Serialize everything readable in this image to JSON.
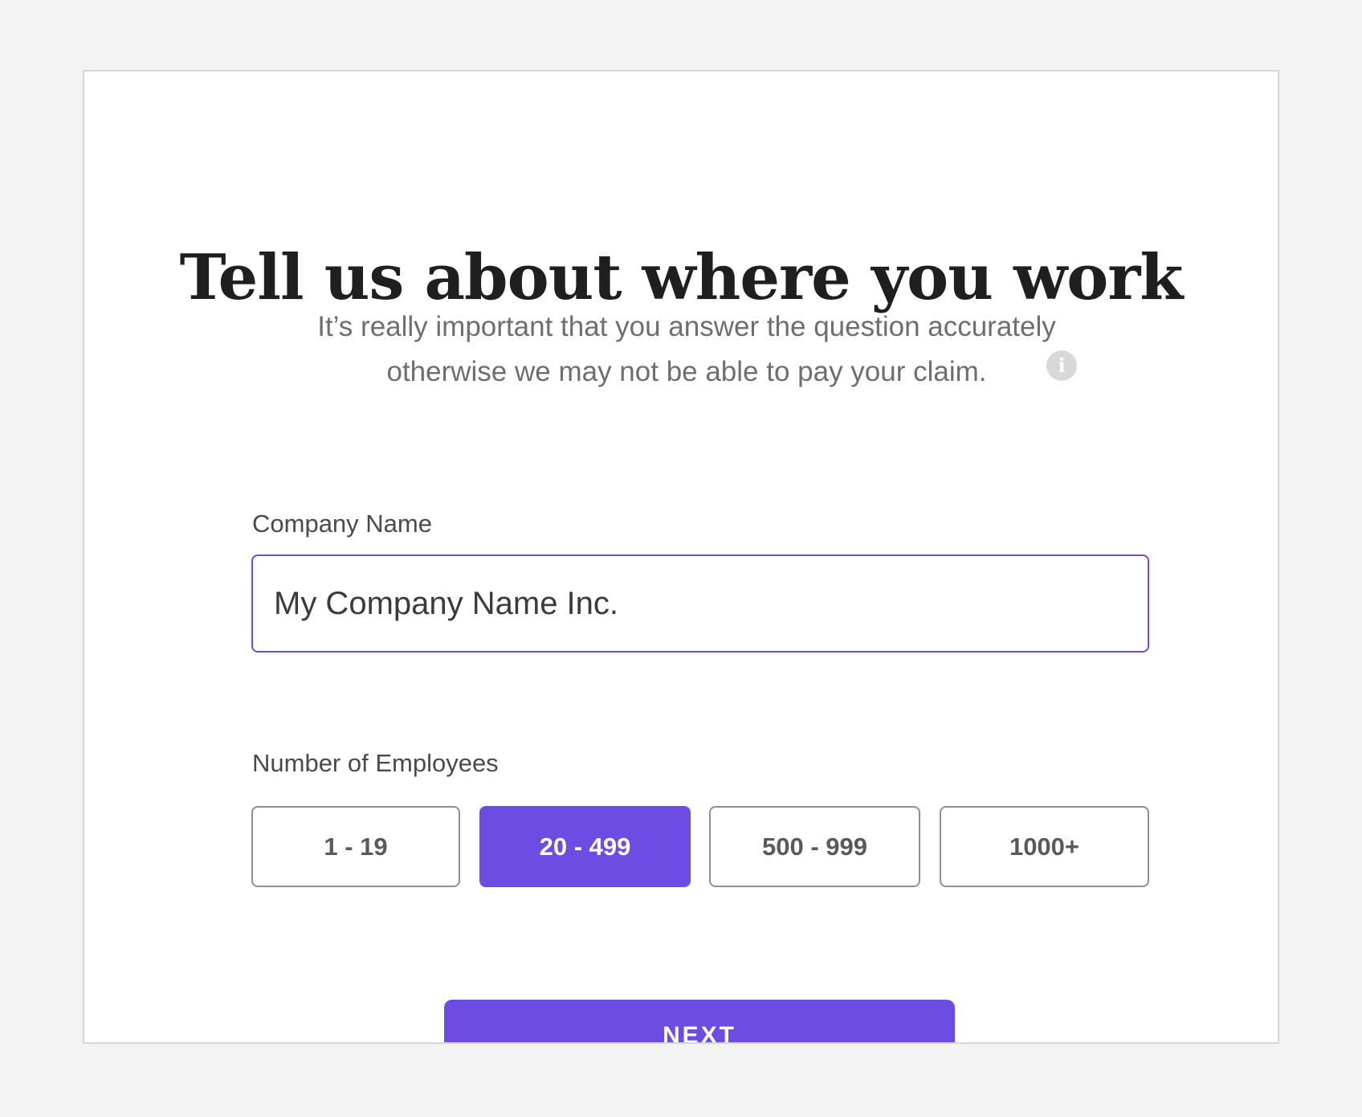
{
  "header": {
    "title": "Tell us about where you work",
    "subtitle_line1": "It’s really important that you answer the question accurately",
    "subtitle_line2": "otherwise we may not be able to pay your claim.",
    "info_icon": "info-icon",
    "info_glyph": "i"
  },
  "form": {
    "company_label": "Company Name",
    "company_value": "My Company Name Inc.",
    "employees_label": "Number of Employees",
    "employee_options": [
      "1 - 19",
      "20 - 499",
      "500 - 999",
      "1000+"
    ],
    "selected_employee_option": "20 - 499",
    "next_label": "NEXT"
  },
  "colors": {
    "accent": "#6c4ce2",
    "background": "#f3f3f3",
    "card": "#ffffff",
    "title_text": "#1f1f1f",
    "muted_text": "#6e6e6e"
  }
}
